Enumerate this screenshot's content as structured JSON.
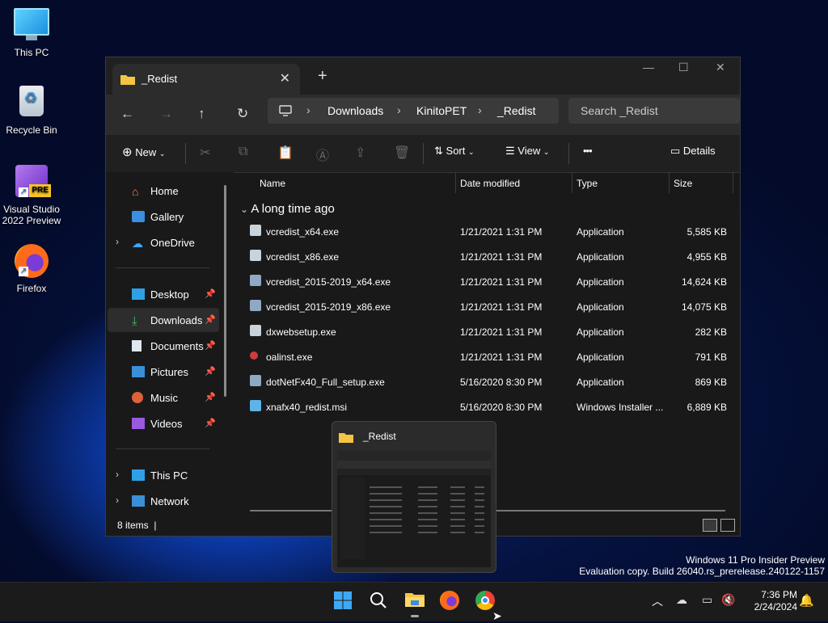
{
  "desktop": {
    "icons": [
      {
        "label": "This PC"
      },
      {
        "label": "Recycle Bin"
      },
      {
        "label": "Visual Studio 2022 Preview",
        "badge": "PRE"
      },
      {
        "label": "Firefox"
      }
    ]
  },
  "window": {
    "tab_title": "_Redist",
    "new_tab_symbol": "+",
    "breadcrumb": [
      "Downloads",
      "KinitoPET",
      "_Redist"
    ],
    "search_placeholder": "Search _Redist",
    "toolbar": {
      "new_label": "New",
      "sort_label": "Sort",
      "view_label": "View",
      "more_label": "•••",
      "details_label": "Details"
    },
    "nav": {
      "home": "Home",
      "gallery": "Gallery",
      "onedrive": "OneDrive",
      "desktop": "Desktop",
      "downloads": "Downloads",
      "documents": "Documents",
      "pictures": "Pictures",
      "music": "Music",
      "videos": "Videos",
      "thispc": "This PC",
      "network": "Network"
    },
    "columns": {
      "name": "Name",
      "date": "Date modified",
      "type": "Type",
      "size": "Size"
    },
    "group_label": "A long time ago",
    "files": [
      {
        "name": "vcredist_x64.exe",
        "date": "1/21/2021 1:31 PM",
        "type": "Application",
        "size": "5,585 KB",
        "icon": "installer-icon"
      },
      {
        "name": "vcredist_x86.exe",
        "date": "1/21/2021 1:31 PM",
        "type": "Application",
        "size": "4,955 KB",
        "icon": "installer-icon"
      },
      {
        "name": "vcredist_2015-2019_x64.exe",
        "date": "1/21/2021 1:31 PM",
        "type": "Application",
        "size": "14,624 KB",
        "icon": "installer-icon"
      },
      {
        "name": "vcredist_2015-2019_x86.exe",
        "date": "1/21/2021 1:31 PM",
        "type": "Application",
        "size": "14,075 KB",
        "icon": "installer-icon"
      },
      {
        "name": "dxwebsetup.exe",
        "date": "1/21/2021 1:31 PM",
        "type": "Application",
        "size": "282 KB",
        "icon": "directx-icon"
      },
      {
        "name": "oalinst.exe",
        "date": "1/21/2021 1:31 PM",
        "type": "Application",
        "size": "791 KB",
        "icon": "openal-icon"
      },
      {
        "name": "dotNetFx40_Full_setup.exe",
        "date": "5/16/2020 8:30 PM",
        "type": "Application",
        "size": "869 KB",
        "icon": "installer-icon"
      },
      {
        "name": "xnafx40_redist.msi",
        "date": "5/16/2020 8:30 PM",
        "type": "Windows Installer ...",
        "size": "6,889 KB",
        "icon": "msi-icon"
      }
    ],
    "status_count": "8 items"
  },
  "thumbnail": {
    "title": "_Redist"
  },
  "watermark": {
    "line1": "Windows 11 Pro Insider Preview",
    "line2": "Evaluation copy. Build 26040.rs_prerelease.240122-1157"
  },
  "taskbar": {
    "time": "7:36 PM",
    "date": "2/24/2024"
  },
  "colors": {
    "accent": "#0078d4",
    "folder": "#f4c542"
  }
}
